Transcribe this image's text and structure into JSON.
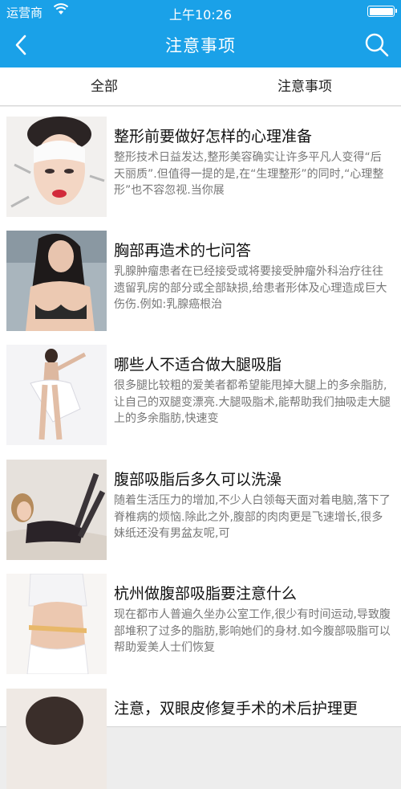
{
  "status_bar": {
    "carrier": "运营商",
    "time": "上午10:26"
  },
  "nav": {
    "title": "注意事项"
  },
  "tabs": [
    {
      "label": "全部"
    },
    {
      "label": "注意事项"
    }
  ],
  "articles": [
    {
      "title": "整形前要做好怎样的心理准备",
      "summary": "整形技术日益发达,整形美容确实让许多平凡人变得“后天丽质”.但值得一提的是,在“生理整形”的同时,“心理整形”也不容忽视.当你展"
    },
    {
      "title": "胸部再造术的七问答",
      "summary": "乳腺肿瘤患者在已经接受或将要接受肿瘤外科治疗往往遗留乳房的部分或全部缺损,给患者形体及心理造成巨大伤伤.例如:乳腺癌根治"
    },
    {
      "title": "哪些人不适合做大腿吸脂",
      "summary": "很多腿比较粗的爱美者都希望能甩掉大腿上的多余脂肪,让自己的双腿变漂亮.大腿吸脂术,能帮助我们抽吸走大腿上的多余脂肪,快速变"
    },
    {
      "title": "腹部吸脂后多久可以洗澡",
      "summary": "随着生活压力的增加,不少人白领每天面对着电脑,落下了脊椎病的烦恼.除此之外,腹部的肉肉更是飞速增长,很多妹纸还没有男盆友呢,可"
    },
    {
      "title": "杭州做腹部吸脂要注意什么",
      "summary": "现在都市人普遍久坐办公室工作,很少有时间运动,导致腹部堆积了过多的脂肪,影响她们的身材.如今腹部吸脂可以帮助爱美人士们恢复"
    },
    {
      "title": "注意，双眼皮修复手术的术后护理更",
      "summary": ""
    }
  ]
}
